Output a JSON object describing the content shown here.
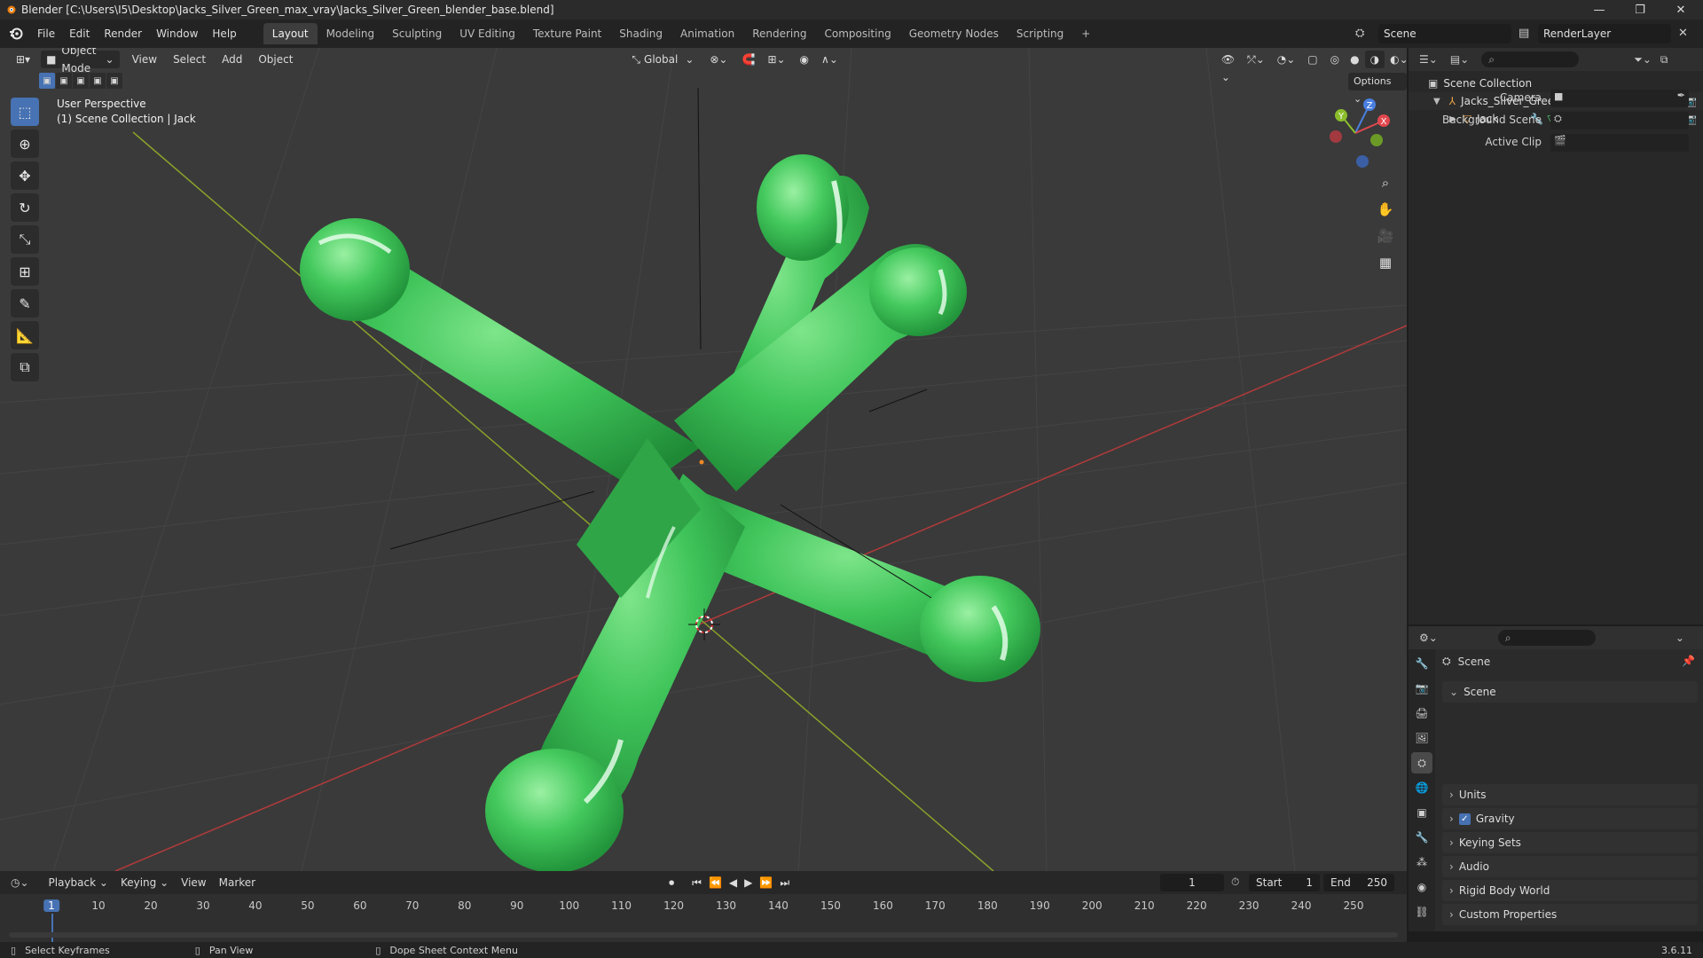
{
  "window": {
    "title": "Blender [C:\\Users\\I5\\Desktop\\Jacks_Silver_Green_max_vray\\Jacks_Silver_Green_blender_base.blend]",
    "minimize": "—",
    "maximize": "❐",
    "close": "✕"
  },
  "menu": [
    "File",
    "Edit",
    "Render",
    "Window",
    "Help"
  ],
  "workspaces": [
    "Layout",
    "Modeling",
    "Sculpting",
    "UV Editing",
    "Texture Paint",
    "Shading",
    "Animation",
    "Rendering",
    "Compositing",
    "Geometry Nodes",
    "Scripting",
    "+"
  ],
  "active_workspace": "Layout",
  "scene_selector": {
    "value": "Scene"
  },
  "view_layer": {
    "value": "RenderLayer"
  },
  "viewport": {
    "mode": "Object Mode",
    "menus": [
      "View",
      "Select",
      "Add",
      "Object"
    ],
    "orientation": "Global",
    "options_label": "Options",
    "perspective_label": "User Perspective",
    "collection_label": "(1) Scene Collection | Jack",
    "gizmo_axes": {
      "x": "X",
      "y": "Y",
      "z": "Z"
    }
  },
  "outliner": {
    "root": "Scene Collection",
    "collection": "Jacks_Silver_Green",
    "object": "Jack"
  },
  "properties": {
    "context": "Scene",
    "panel_title": "Scene",
    "camera_label": "Camera",
    "background_scene_label": "Background Scene",
    "active_clip_label": "Active Clip",
    "sections": [
      "Units",
      "Gravity",
      "Keying Sets",
      "Audio",
      "Rigid Body World",
      "Custom Properties"
    ],
    "gravity_checked": true
  },
  "timeline": {
    "menus": [
      "Playback",
      "Keying",
      "View",
      "Marker"
    ],
    "current_frame": "1",
    "start_label": "Start",
    "start_value": "1",
    "end_label": "End",
    "end_value": "250",
    "ruler": [
      "1",
      "10",
      "20",
      "30",
      "40",
      "50",
      "60",
      "70",
      "80",
      "90",
      "100",
      "110",
      "120",
      "130",
      "140",
      "150",
      "160",
      "170",
      "180",
      "190",
      "200",
      "210",
      "220",
      "230",
      "240",
      "250"
    ]
  },
  "statusbar": {
    "hint1": "Select Keyframes",
    "hint2": "Pan View",
    "hint3": "Dope Sheet Context Menu",
    "version": "3.6.11"
  },
  "colors": {
    "accent": "#4772b3",
    "jack_green": "#3fc45a",
    "x_axis": "#b23a3a",
    "y_axis": "#8aa12b"
  }
}
